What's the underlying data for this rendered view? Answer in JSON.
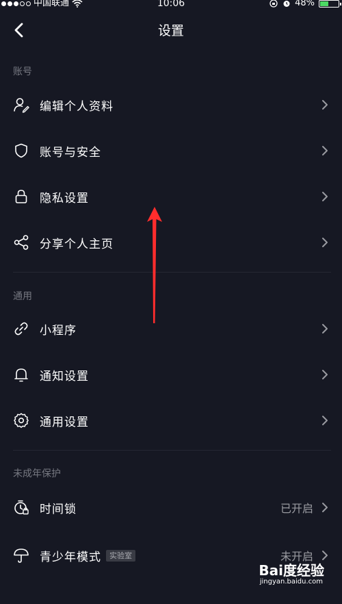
{
  "status_bar": {
    "carrier": "中国联通",
    "time": "10:06",
    "battery_percent": "48%",
    "battery_level": 0.48
  },
  "nav": {
    "title": "设置"
  },
  "sections": {
    "account": {
      "title": "账号",
      "items": [
        {
          "label": "编辑个人资料",
          "icon": "edit-user-icon"
        },
        {
          "label": "账号与安全",
          "icon": "shield-icon"
        },
        {
          "label": "隐私设置",
          "icon": "lock-icon"
        },
        {
          "label": "分享个人主页",
          "icon": "share-icon"
        }
      ]
    },
    "general": {
      "title": "通用",
      "items": [
        {
          "label": "小程序",
          "icon": "link-icon"
        },
        {
          "label": "通知设置",
          "icon": "bell-icon"
        },
        {
          "label": "通用设置",
          "icon": "gear-icon"
        }
      ]
    },
    "minor": {
      "title": "未成年保护",
      "items": [
        {
          "label": "时间锁",
          "value": "已开启",
          "icon": "time-lock-icon"
        },
        {
          "label": "青少年模式",
          "badge": "实验室",
          "value": "未开启",
          "icon": "umbrella-icon"
        }
      ]
    }
  },
  "watermark": {
    "logo": "Bai度经验",
    "url": "jingyan.baidu.com"
  },
  "colors": {
    "background": "#161823",
    "section_title": "#767881",
    "annotation": "#ff2d2d",
    "battery": "#4cd964"
  }
}
